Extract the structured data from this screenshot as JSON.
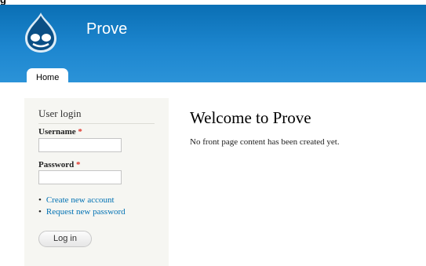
{
  "top_strip_text": "g",
  "site": {
    "name": "Prove",
    "logo_icon": "drupal-drop-icon"
  },
  "nav": {
    "tabs": [
      {
        "label": "Home"
      }
    ]
  },
  "colors": {
    "header": "#1a7fc7",
    "link": "#0071b3",
    "required": "#e0362c",
    "sidebar_bg": "#f6f6f2"
  },
  "login_block": {
    "title": "User login",
    "username_label": "Username",
    "password_label": "Password",
    "required_mark": "*",
    "username_value": "",
    "password_value": "",
    "links": [
      {
        "label": "Create new account"
      },
      {
        "label": "Request new password"
      }
    ],
    "submit_label": "Log in"
  },
  "main": {
    "title": "Welcome to Prove",
    "text": "No front page content has been created yet."
  }
}
